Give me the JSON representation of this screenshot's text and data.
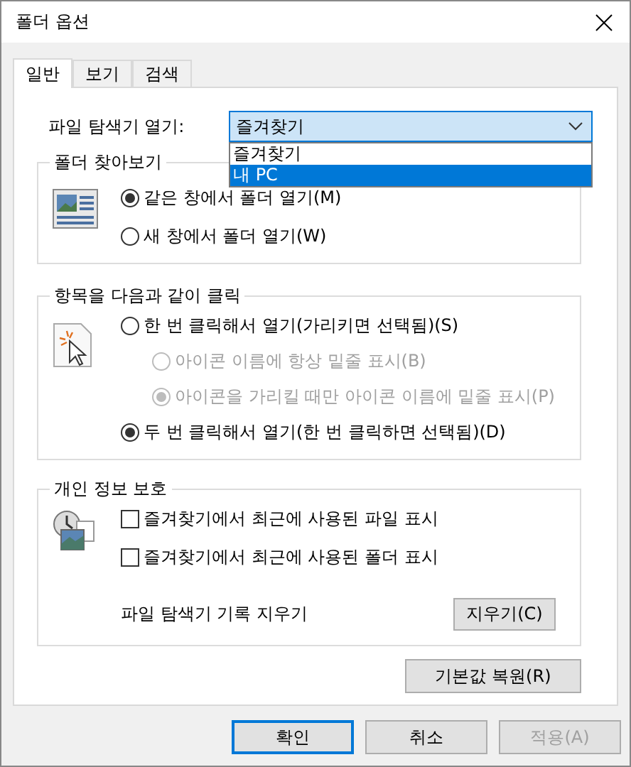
{
  "window": {
    "title": "폴더 옵션"
  },
  "tabs": [
    {
      "label": "일반",
      "selected": true
    },
    {
      "label": "보기",
      "selected": false
    },
    {
      "label": "검색",
      "selected": false
    }
  ],
  "open_explorer": {
    "label": "파일 탐색기 열기:",
    "value": "즐겨찾기",
    "expanded": true,
    "options": [
      {
        "label": "즐겨찾기",
        "highlighted": false
      },
      {
        "label": "내 PC",
        "highlighted": true
      }
    ]
  },
  "groups": [
    {
      "title": "폴더 찾아보기",
      "kind": "radios",
      "options": [
        {
          "label": "같은 창에서 폴더 열기(M)",
          "selected": true,
          "disabled": false
        },
        {
          "label": "새 창에서 폴더 열기(W)",
          "selected": false,
          "disabled": false
        }
      ]
    },
    {
      "title": "항목을 다음과 같이 클릭",
      "kind": "radios",
      "options": [
        {
          "label": "한 번 클릭해서 열기(가리키면 선택됨)(S)",
          "selected": false,
          "disabled": false,
          "children": [
            {
              "label": "아이콘 이름에 항상 밑줄 표시(B)",
              "selected": false,
              "disabled": true
            },
            {
              "label": "아이콘을 가리킬 때만 아이콘 이름에 밑줄 표시(P)",
              "selected": true,
              "disabled": true
            }
          ]
        },
        {
          "label": "두 번 클릭해서 열기(한 번 클릭하면 선택됨)(D)",
          "selected": true,
          "disabled": false
        }
      ]
    },
    {
      "title": "개인 정보 보호",
      "kind": "privacy",
      "options": [
        {
          "label": "즐겨찾기에서 최근에 사용된 파일 표시",
          "checked": false
        },
        {
          "label": "즐겨찾기에서 최근에 사용된 폴더 표시",
          "checked": false
        }
      ],
      "clear_label": "파일 탐색기 기록 지우기",
      "clear_button": "지우기(C)"
    }
  ],
  "restore_button": "기본값 복원(R)",
  "buttons": [
    {
      "label": "확인",
      "default": true,
      "disabled": false
    },
    {
      "label": "취소",
      "default": false,
      "disabled": false
    },
    {
      "label": "적용(A)",
      "default": false,
      "disabled": true
    }
  ]
}
